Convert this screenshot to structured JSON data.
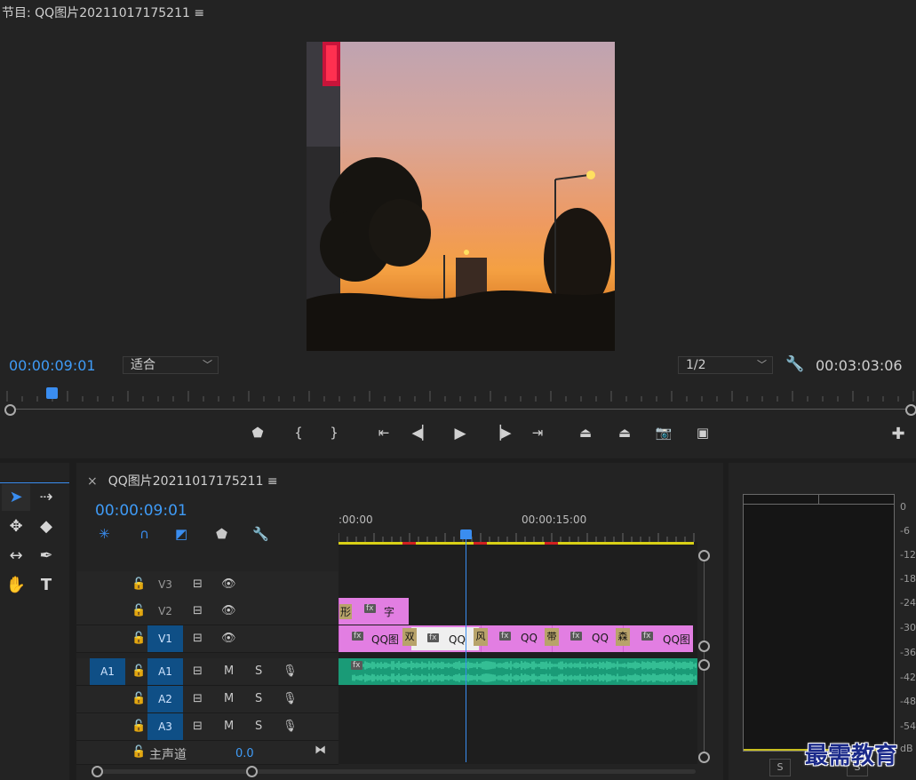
{
  "program_monitor": {
    "title": "节目: QQ图片20211017175211 ≡",
    "current_time": "00:00:09:01",
    "fit_option": "适合",
    "resolution": "1/2",
    "duration": "00:03:03:06",
    "playhead_fraction": 0.05
  },
  "transport_icons": [
    "marker-icon",
    "mark-in-icon",
    "mark-out-icon",
    "go-to-in-icon",
    "step-back-icon",
    "play-icon",
    "step-forward-icon",
    "go-to-out-icon",
    "lift-icon",
    "extract-icon",
    "camera-icon",
    "compare-icon",
    "add-icon"
  ],
  "timeline": {
    "close": "×",
    "title": "QQ图片20211017175211 ≡",
    "current_time": "00:00:09:01",
    "ruler_labels": [
      ":00:00",
      "00:00:15:00"
    ],
    "tracks_video": [
      {
        "label": "V3"
      },
      {
        "label": "V2"
      },
      {
        "label": "V1"
      }
    ],
    "tracks_audio": [
      {
        "source": "A1",
        "label": "A1",
        "m": "M",
        "s": "S"
      },
      {
        "label": "A2",
        "m": "M",
        "s": "S"
      },
      {
        "label": "A3",
        "m": "M",
        "s": "S"
      }
    ],
    "master": {
      "label": "主声道",
      "value": "0.0"
    },
    "clips_v2": [
      {
        "a": "形",
        "fx": "fx",
        "b": "字"
      }
    ],
    "clips_v1": [
      {
        "name": "QQ图",
        "fx": "fx"
      },
      {
        "name": "QQ",
        "fx": "fx"
      },
      {
        "name": "QQ",
        "fx": "fx"
      },
      {
        "name": "QQ",
        "fx": "fx"
      },
      {
        "name": "QQ图",
        "fx": "fx"
      }
    ],
    "transitions": [
      "双",
      "风",
      "带",
      "森"
    ],
    "audio_fx": "fx"
  },
  "meters": {
    "db_labels": [
      "0",
      "-6",
      "-12",
      "-18",
      "-24",
      "-30",
      "-36",
      "-42",
      "-48",
      "-54",
      "dB"
    ],
    "solo": [
      "S",
      "S"
    ]
  },
  "watermark": "最需教育",
  "colors": {
    "accent": "#3a8df0",
    "clip": "#e27ee2",
    "audio": "#1a9b77"
  }
}
